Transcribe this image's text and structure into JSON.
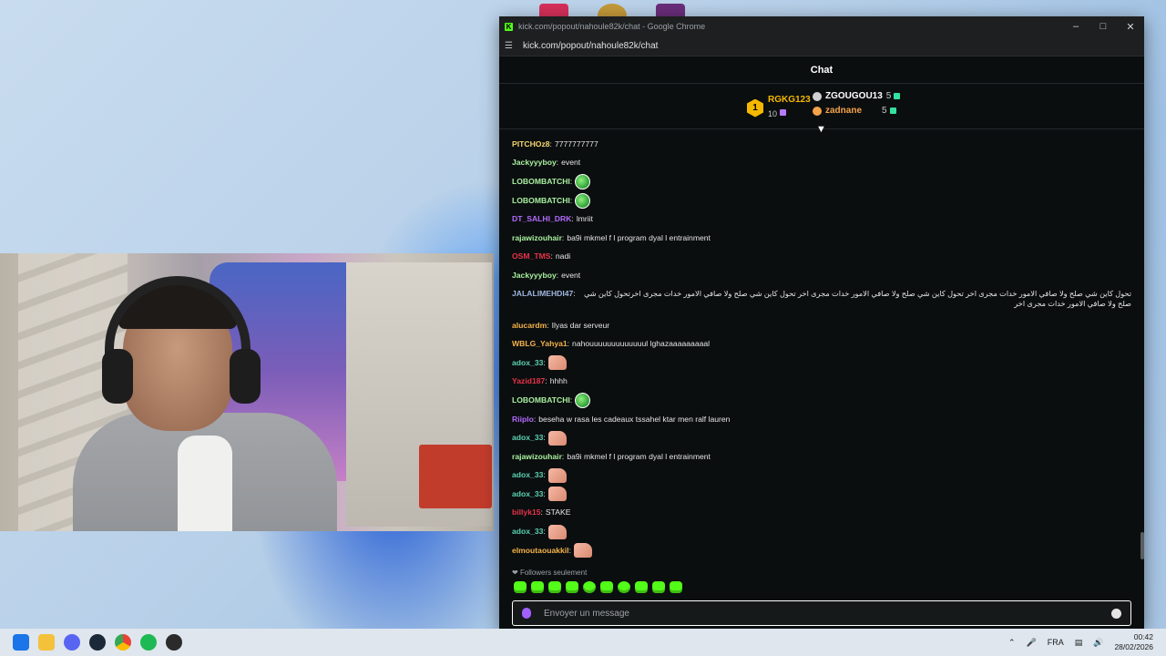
{
  "colors": {
    "kick_green": "#53fc18",
    "first_gold": "#f5b800",
    "chat_bg": "#0b0e0f"
  },
  "browser": {
    "tab_title": "kick.com/popout/nahoule82k/chat - Google Chrome",
    "url": "kick.com/popout/nahoule82k/chat"
  },
  "chat": {
    "title": "Chat",
    "leaderboard": {
      "first": {
        "rank": "1",
        "name": "RGKG123",
        "count": "10"
      },
      "second": {
        "name": "ZGOUGOU13",
        "count": "5"
      },
      "third": {
        "name": "zadnane",
        "count": "5"
      }
    },
    "messages": [
      {
        "user": "PITCHOz8",
        "color": "#f5d76e",
        "text": "7777777777"
      },
      {
        "user": "Jackyyyboy",
        "color": "#a8f0a0",
        "text": "event"
      },
      {
        "user": "LOBOMBATCHI",
        "color": "#a8f0a0",
        "text": "",
        "emote": "lobo"
      },
      {
        "user": "LOBOMBATCHI",
        "color": "#a8f0a0",
        "text": "",
        "emote": "lobo"
      },
      {
        "user": "DT_SALHI_DRK",
        "color": "#b36bff",
        "text": "lmriit"
      },
      {
        "user": "rajawizouhair",
        "color": "#a8f0a0",
        "text": "ba9i mkmel f l program dyal l entrainment"
      },
      {
        "user": "OSM_TMS",
        "color": "#e8334a",
        "text": "nadi"
      },
      {
        "user": "Jackyyyboy",
        "color": "#a8f0a0",
        "text": "event"
      },
      {
        "user": "JALALIMEHDI47",
        "color": "#9fb6e0",
        "text": "تحول كاين شي صلح ولا صافي الامور خدات مجرى اخر تحول كاين شي صلح ولا صافي الامور خدات مجرى اخر تحول كاين شي صلح ولا صافي الامور خدات مجرى اخرتحول كاين شي صلح ولا صافي الامور خدات مجرى اخر",
        "tall": true
      },
      {
        "user": "alucardm",
        "color": "#f5b34a",
        "text": "Ilyas dar serveur"
      },
      {
        "user": "WBLG_Yahya1",
        "color": "#f5b34a",
        "text": "nahouuuuuuuuuuuuul lghazaaaaaaaaal"
      },
      {
        "user": "adox_33",
        "color": "#5ad1b0",
        "text": "",
        "emote": "hand"
      },
      {
        "user": "Yazid187",
        "color": "#e8334a",
        "text": "hhhh"
      },
      {
        "user": "LOBOMBATCHI",
        "color": "#a8f0a0",
        "text": "",
        "emote": "lobo"
      },
      {
        "user": "Riiplo",
        "color": "#b36bff",
        "text": "beseha w rasa les cadeaux tssahel ktar men ralf lauren"
      },
      {
        "user": "adox_33",
        "color": "#5ad1b0",
        "text": "",
        "emote": "hand"
      },
      {
        "user": "rajawizouhair",
        "color": "#a8f0a0",
        "text": "ba9i mkmel f l program dyal l entrainment"
      },
      {
        "user": "adox_33",
        "color": "#5ad1b0",
        "text": "",
        "emote": "hand"
      },
      {
        "user": "adox_33",
        "color": "#5ad1b0",
        "text": "",
        "emote": "hand"
      },
      {
        "user": "billyk15",
        "color": "#e8334a",
        "text": "STAKE"
      },
      {
        "user": "adox_33",
        "color": "#5ad1b0",
        "text": "",
        "emote": "hand"
      },
      {
        "user": "elmoutaouakkil",
        "color": "#f5b34a",
        "text": "",
        "emote": "hand"
      }
    ],
    "followers_mode": "Followers seulement",
    "input_placeholder": "Envoyer un message"
  },
  "taskbar": {
    "language": "FRA",
    "time": "00:42",
    "date": "28/02/2026"
  }
}
